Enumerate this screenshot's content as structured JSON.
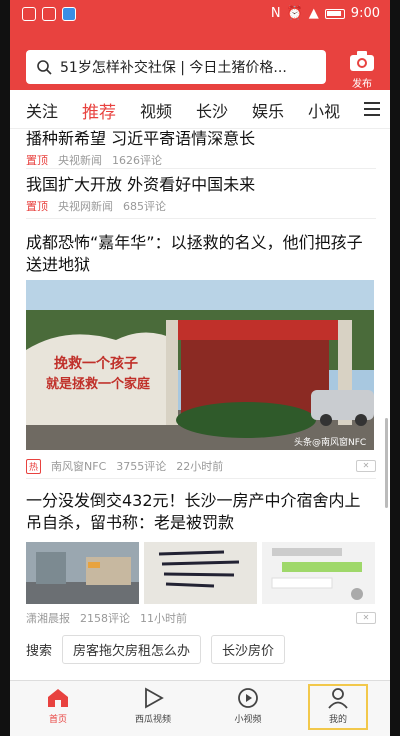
{
  "status": {
    "time": "9:00"
  },
  "search": {
    "query": "51岁怎样补交社保 | 今日土猪价格..."
  },
  "publish": {
    "label": "发布"
  },
  "tabs": [
    "关注",
    "推荐",
    "视频",
    "长沙",
    "娱乐",
    "小视"
  ],
  "feed": {
    "item1": {
      "title": "播种新希望 习近平寄语情深意长",
      "pin": "置顶",
      "source": "央视新闻",
      "comments": "1626评论"
    },
    "item2": {
      "title": "我国扩大开放 外资看好中国未来",
      "pin": "置顶",
      "source": "央视网新闻",
      "comments": "685评论"
    },
    "item3": {
      "title": "成都恐怖“嘉年华”：以拯救的名义，他们把孩子送进地狱",
      "hot": "热",
      "source": "南风窗NFC",
      "comments": "3755评论",
      "time": "22小时前",
      "image_text": {
        "line1": "挽救一个孩子",
        "line2": "就是拯救一个家庭",
        "watermark": "头条@南风窗NFC"
      }
    },
    "item4": {
      "title": "一分没发倒交432元！长沙一房产中介宿舍内上吊自杀，留书称：老是被罚款",
      "source": "潇湘晨报",
      "comments": "2158评论",
      "time": "11小时前"
    },
    "search_row": {
      "label": "搜索",
      "chips": [
        "房客拖欠房租怎么办",
        "长沙房价"
      ]
    }
  },
  "nav": [
    {
      "label": "首页",
      "icon": "home-icon"
    },
    {
      "label": "西瓜视频",
      "icon": "play-icon"
    },
    {
      "label": "小视频",
      "icon": "short-video-icon"
    },
    {
      "label": "我的",
      "icon": "profile-icon"
    }
  ],
  "colors": {
    "brand": "#e8423f",
    "highlight": "#f2c84b"
  }
}
